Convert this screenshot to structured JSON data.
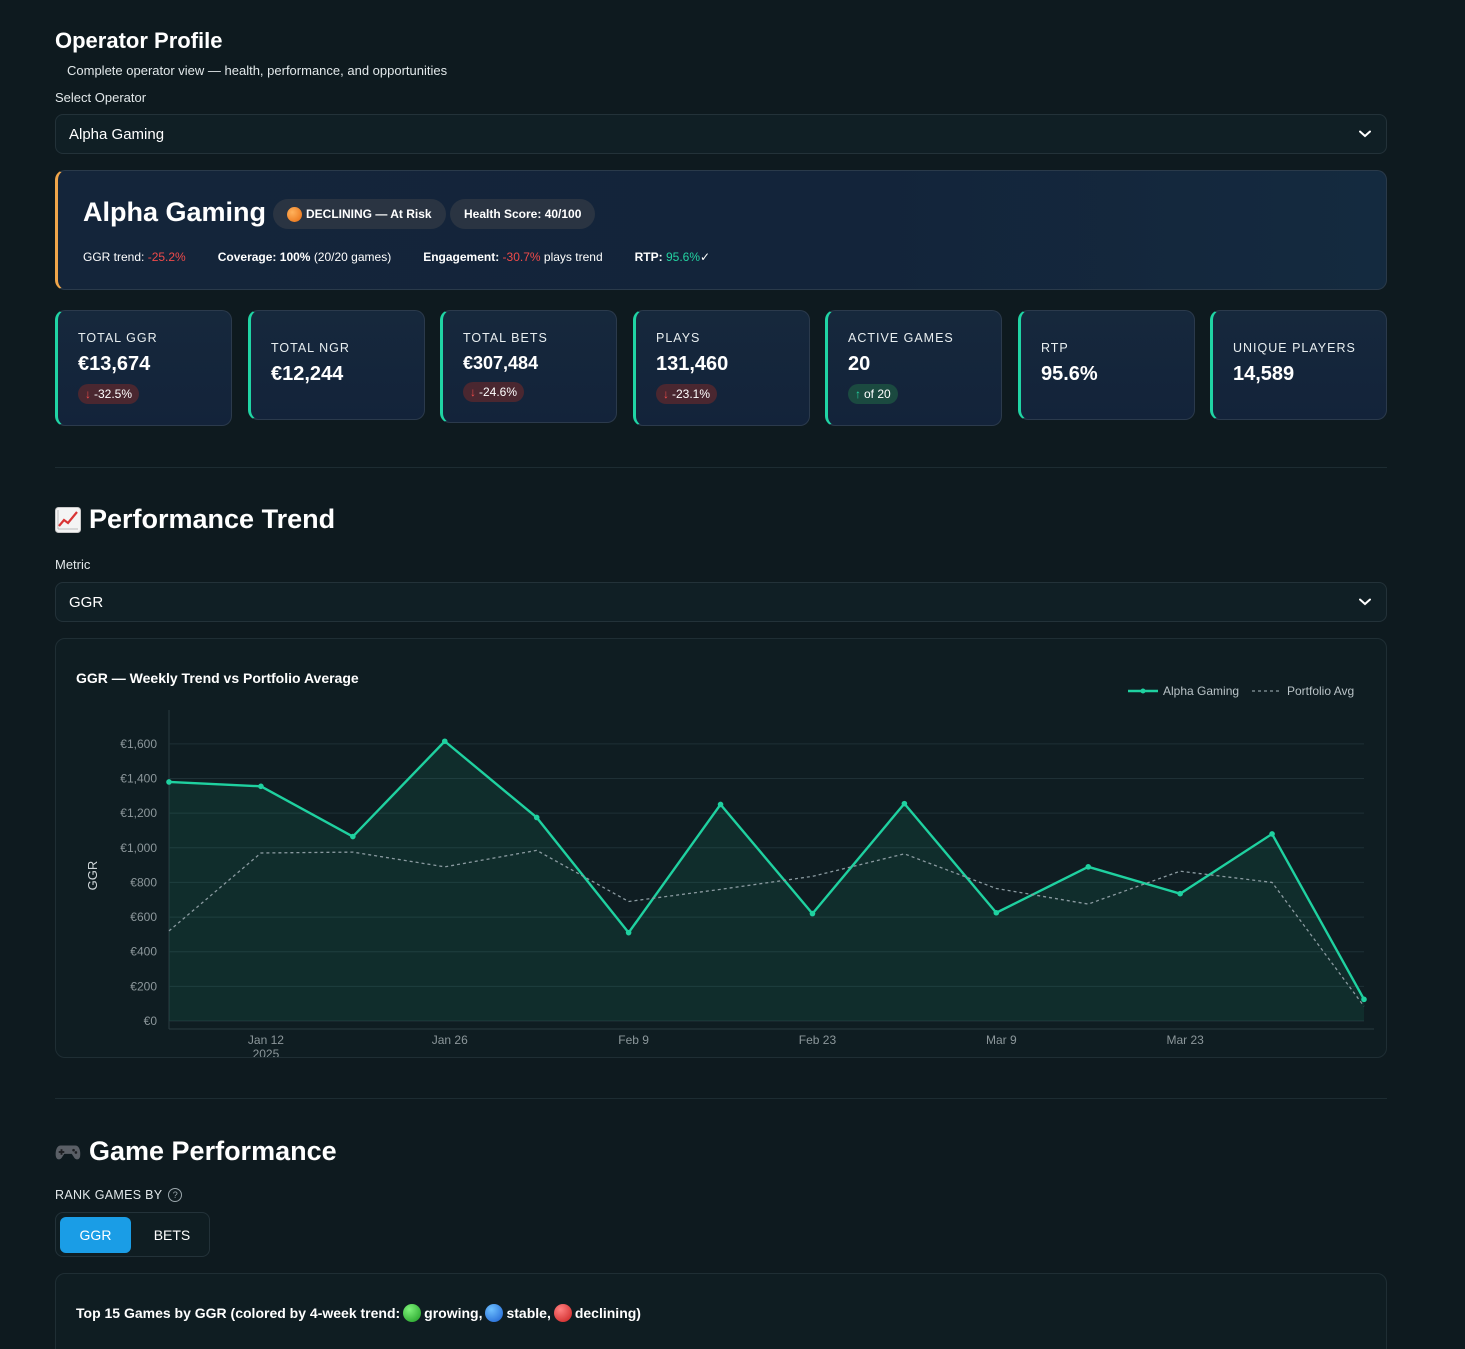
{
  "page": {
    "title": "Operator Profile",
    "subtitle": "Complete operator view — health, performance, and opportunities"
  },
  "operator_select": {
    "label": "Select Operator",
    "value": "Alpha Gaming"
  },
  "operator_card": {
    "name": "Alpha Gaming",
    "status_badge": "DECLINING — At Risk",
    "health_badge": "Health Score: 40/100",
    "ggr_trend_label": "GGR trend:",
    "ggr_trend_value": "-25.2%",
    "coverage_label": "Coverage:",
    "coverage_value": "100%",
    "coverage_detail": "(20/20 games)",
    "engagement_label": "Engagement:",
    "engagement_value": "-30.7%",
    "engagement_suffix": "plays trend",
    "rtp_label": "RTP:",
    "rtp_value": "95.6%",
    "rtp_check": "✓",
    "accent_color": "#f0a64a"
  },
  "kpis": [
    {
      "label": "TOTAL GGR",
      "value": "€13,674",
      "delta": "-32.5%",
      "direction": "down"
    },
    {
      "label": "TOTAL NGR",
      "value": "€12,244"
    },
    {
      "label": "TOTAL BETS",
      "value": "€307,484",
      "delta": "-24.6%",
      "direction": "down"
    },
    {
      "label": "PLAYS",
      "value": "131,460",
      "delta": "-23.1%",
      "direction": "down"
    },
    {
      "label": "ACTIVE GAMES",
      "value": "20",
      "delta": "of 20",
      "direction": "up"
    },
    {
      "label": "RTP",
      "value": "95.6%"
    },
    {
      "label": "UNIQUE PLAYERS",
      "value": "14,589"
    }
  ],
  "performance": {
    "title": "Performance Trend",
    "icon": "chart-increasing-icon",
    "metric_label": "Metric",
    "metric_value": "GGR"
  },
  "chart_data": {
    "type": "line",
    "title": "GGR — Weekly Trend vs Portfolio Average",
    "ylabel": "GGR",
    "xlabel": "",
    "ylim": [
      0,
      1680
    ],
    "y_ticks": [
      "€0",
      "€200",
      "€400",
      "€600",
      "€800",
      "€1,000",
      "€1,200",
      "€1,400",
      "€1,600"
    ],
    "x_tick_labels": [
      "Jan 12",
      "Jan 26",
      "Feb 9",
      "Feb 23",
      "Mar 9",
      "Mar 23"
    ],
    "x_tick_year": "2025",
    "x_tick_weeks": [
      1,
      3,
      5,
      7,
      9,
      11
    ],
    "x": [
      "2025-01-05",
      "2025-01-12",
      "2025-01-19",
      "2025-01-26",
      "2025-02-02",
      "2025-02-09",
      "2025-02-16",
      "2025-02-23",
      "2025-03-02",
      "2025-03-09",
      "2025-03-16",
      "2025-03-23",
      "2025-03-30"
    ],
    "legend_position": "top-right",
    "grid": true,
    "series": [
      {
        "name": "Alpha Gaming",
        "color": "#1fd1a0",
        "style": "solid",
        "markers": true,
        "values": [
          1380,
          1355,
          1065,
          1615,
          1175,
          510,
          1250,
          620,
          1255,
          625,
          890,
          735,
          1080,
          125
        ]
      },
      {
        "name": "Portfolio Avg",
        "color": "#8a9aa0",
        "style": "dashed",
        "markers": false,
        "values": [
          520,
          970,
          975,
          890,
          985,
          690,
          760,
          835,
          965,
          765,
          675,
          865,
          800,
          85
        ]
      }
    ]
  },
  "game_performance": {
    "title": "Game Performance",
    "icon": "game-controller-icon",
    "rank_label": "RANK GAMES BY",
    "rank_options": [
      "GGR",
      "BETS"
    ],
    "rank_selected": "GGR",
    "chart_title_prefix": "Top 15 Games by GGR (colored by 4-week trend:",
    "trend_growing": "growing,",
    "trend_stable": "stable,",
    "trend_declining": "declining)"
  }
}
